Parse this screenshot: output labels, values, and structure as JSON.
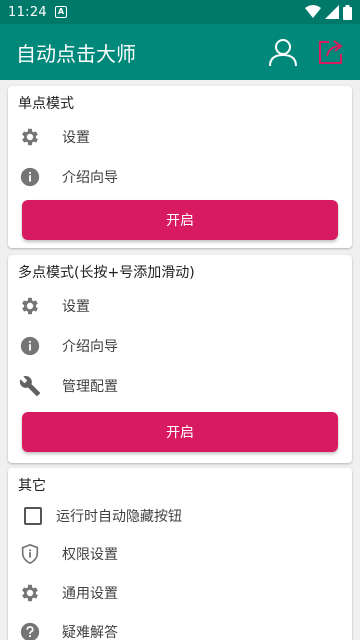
{
  "status_bar": {
    "time": "11:24",
    "badge": "A"
  },
  "app_bar": {
    "title": "自动点击大师"
  },
  "single_mode": {
    "title": "单点模式",
    "settings_label": "设置",
    "guide_label": "介绍向导",
    "start_label": "开启"
  },
  "multi_mode": {
    "title": "多点模式(长按+号添加滑动)",
    "settings_label": "设置",
    "guide_label": "介绍向导",
    "manage_label": "管理配置",
    "start_label": "开启"
  },
  "other": {
    "title": "其它",
    "auto_hide_label": "运行时自动隐藏按钮",
    "auto_hide_checked": false,
    "permissions_label": "权限设置",
    "general_label": "通用设置",
    "faq_label": "疑难解答"
  },
  "colors": {
    "app_bar": "#00897b",
    "status_bar": "#00796b",
    "accent_button": "#d81b60"
  }
}
